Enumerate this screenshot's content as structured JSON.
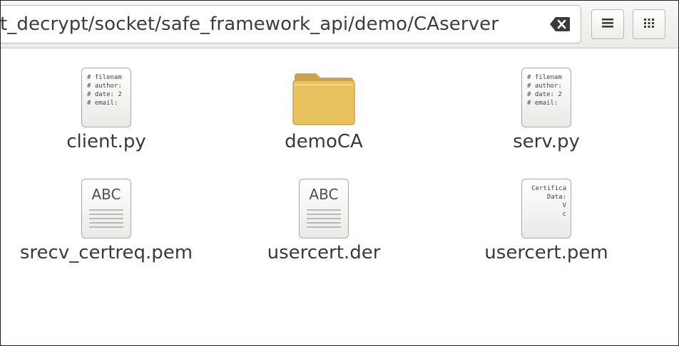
{
  "location": {
    "path": "t_decrypt/socket/safe_framework_api/demo/CAserver"
  },
  "toolbar": {
    "clear_icon": "backspace-icon",
    "list_view_icon": "list-view-icon",
    "grid_view_icon": "grid-view-icon"
  },
  "files": [
    {
      "name": "client.py",
      "icon": "text-x-python",
      "preview": [
        "# filenam",
        "# author:",
        "# date: 2",
        "# email:"
      ]
    },
    {
      "name": "demoCA",
      "icon": "folder"
    },
    {
      "name": "serv.py",
      "icon": "text-x-python",
      "preview": [
        "# filenam",
        "# author:",
        "# date: 2",
        "# email:"
      ]
    },
    {
      "name": "srecv_certreq.pem",
      "icon": "text-generic",
      "preview_heading": "ABC"
    },
    {
      "name": "usercert.der",
      "icon": "text-generic",
      "preview_heading": "ABC"
    },
    {
      "name": "usercert.pem",
      "icon": "text-x-cert",
      "preview": [
        "Certifica",
        "Data:",
        "V",
        "c"
      ]
    }
  ],
  "colors": {
    "folder": "#e8c25f",
    "border": "#1f1f1f"
  }
}
